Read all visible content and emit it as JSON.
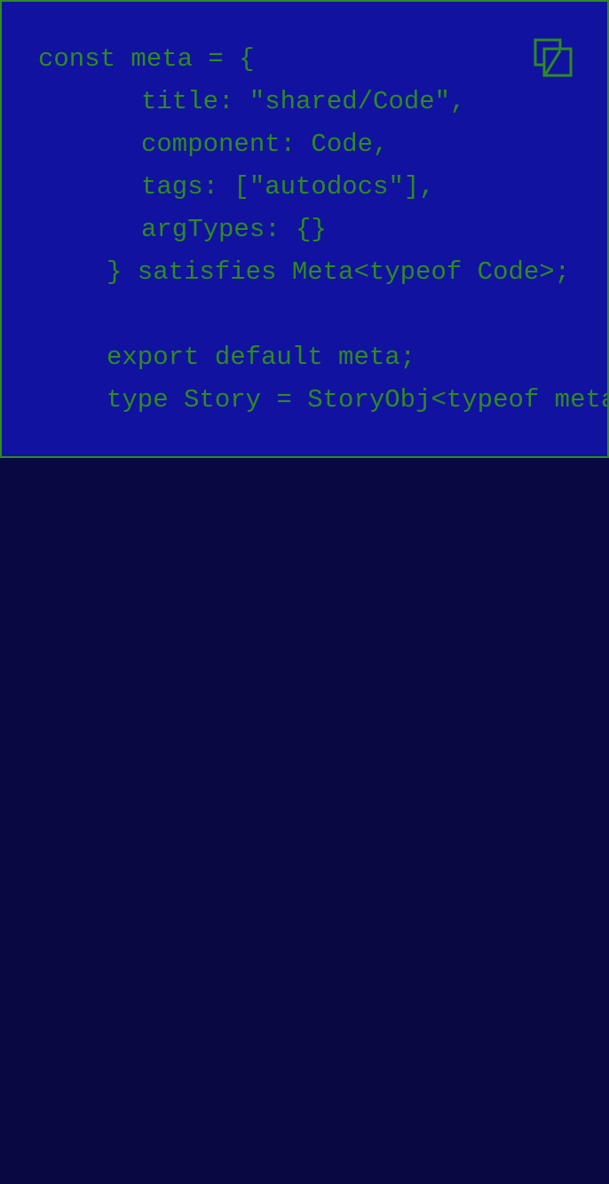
{
  "code": {
    "lines": [
      "const meta = {",
      "title: \"shared/Code\",",
      "component: Code,",
      "tags: [\"autodocs\"],",
      "argTypes: {}",
      "} satisfies Meta<typeof Code>;",
      "",
      "export default meta;",
      "type Story = StoryObj<typeof meta>;"
    ]
  },
  "copy_button": {
    "icon": "copy-icon"
  },
  "colors": {
    "page_background": "#080842",
    "code_background": "#1212a0",
    "code_text": "#2e8b1f",
    "border": "#2e8b1f"
  }
}
